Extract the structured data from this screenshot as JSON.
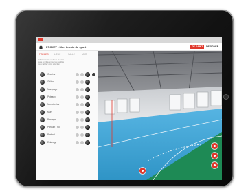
{
  "header": {
    "project_title": "PROJET - Mon terrain de sport",
    "brand_badge": "DE SAINT",
    "brand_suffix": "DESIGNER"
  },
  "tabs": [
    "FORMES",
    "LIEUX",
    "SALLE",
    "MUR"
  ],
  "description": [
    "Choisissez les couleurs de votre",
    "salle en cliquant sur les pastilles",
    "puis validez votre selection."
  ],
  "materials": [
    {
      "label": "Gradins"
    },
    {
      "label": "Grilles"
    },
    {
      "label": "Marquage"
    },
    {
      "label": "Poteaux"
    },
    {
      "label": "Menuiseries"
    },
    {
      "label": "Murs"
    },
    {
      "label": "Bardage"
    },
    {
      "label": "Parquet / Sol"
    },
    {
      "label": "Plafond"
    },
    {
      "label": "Eclairage"
    }
  ],
  "colors": {
    "accent": "#e0382c",
    "court_blue": "#3aa6d8",
    "court_green": "#1e8a55"
  },
  "icons": [
    "home-icon",
    "help-icon",
    "camera-icon",
    "zoom-icon",
    "share-icon"
  ]
}
